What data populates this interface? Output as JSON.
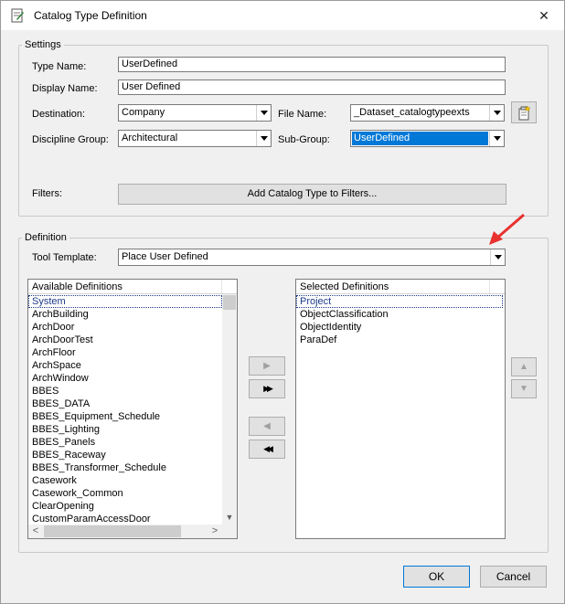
{
  "window": {
    "title": "Catalog Type Definition",
    "close_glyph": "✕"
  },
  "settings": {
    "group_label": "Settings",
    "type_name_label": "Type Name:",
    "type_name_value": "UserDefined",
    "display_name_label": "Display Name:",
    "display_name_value": "User Defined",
    "destination_label": "Destination:",
    "destination_value": "Company",
    "file_name_label": "File Name:",
    "file_name_value": "_Dataset_catalogtypeexts",
    "discipline_group_label": "Discipline Group:",
    "discipline_group_value": "Architectural",
    "sub_group_label": "Sub-Group:",
    "sub_group_value": "UserDefined",
    "filters_label": "Filters:",
    "add_filter_button": "Add Catalog Type to Filters..."
  },
  "definition": {
    "group_label": "Definition",
    "tool_template_label": "Tool Template:",
    "tool_template_value": "Place User Defined",
    "available": {
      "header": "Available Definitions",
      "items": [
        "System",
        "ArchBuilding",
        "ArchDoor",
        "ArchDoorTest",
        "ArchFloor",
        "ArchSpace",
        "ArchWindow",
        "BBES",
        "BBES_DATA",
        "BBES_Equipment_Schedule",
        "BBES_Lighting",
        "BBES_Panels",
        "BBES_Raceway",
        "BBES_Transformer_Schedule",
        "Casework",
        "Casework_Common",
        "ClearOpening",
        "CustomParamAccessDoor"
      ]
    },
    "selected": {
      "header": "Selected Definitions",
      "items": [
        "Project",
        "ObjectClassification",
        "ObjectIdentity",
        "ParaDef"
      ]
    },
    "buttons": {
      "add_one": "▶",
      "add_all": "▶▶",
      "remove_one": "◀",
      "remove_all": "◀◀",
      "move_up": "▲",
      "move_down": "▼"
    },
    "scroll_glyphs": {
      "up": "▲",
      "down": "▼",
      "left": "<",
      "right": ">"
    }
  },
  "footer": {
    "ok_label": "OK",
    "cancel_label": "Cancel"
  },
  "icons": {
    "app": "catalog-app-icon",
    "browse": "browse-file-icon"
  },
  "colors": {
    "selection": "#0078d7",
    "focus_text": "#1c3a8a",
    "annotation_arrow": "#e8312f"
  }
}
